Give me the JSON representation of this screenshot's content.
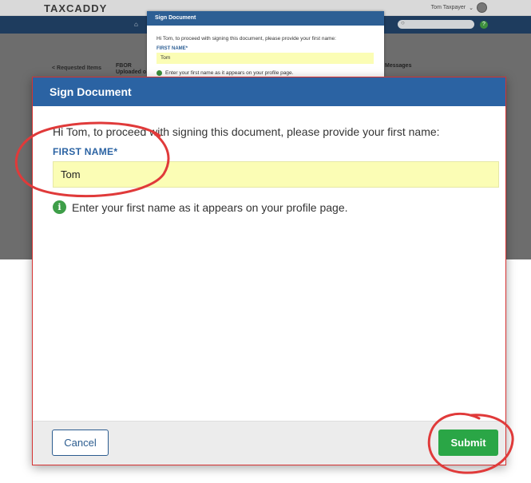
{
  "app": {
    "logo": "TAXCADDY",
    "user_name": "Tom Taxpayer",
    "nav_search_icon": "search-icon",
    "nav_help": "?",
    "crumb_back": "< Requested Items",
    "crumb_title": "FBOR",
    "crumb_sub": "Uploaded o",
    "crumb_messages": "Messages"
  },
  "mini_dialog": {
    "title": "Sign Document",
    "greeting": "Hi Tom, to proceed with signing this document, please provide your first name:",
    "field_label": "FIRST NAME*",
    "field_value": "Tom",
    "hint": "Enter your first name as it appears on your profile page."
  },
  "dialog": {
    "title": "Sign Document",
    "greeting": "Hi Tom, to proceed with signing this document, please provide your first name:",
    "field_label": "FIRST NAME*",
    "field_value": "Tom",
    "hint": "Enter your first name as it appears on your profile page.",
    "info_glyph": "i",
    "cancel_label": "Cancel",
    "submit_label": "Submit"
  },
  "colors": {
    "header_blue": "#2b63a3",
    "input_yellow": "#fbfdb5",
    "submit_green": "#2aa646",
    "annotation_red": "#e03a3a"
  }
}
